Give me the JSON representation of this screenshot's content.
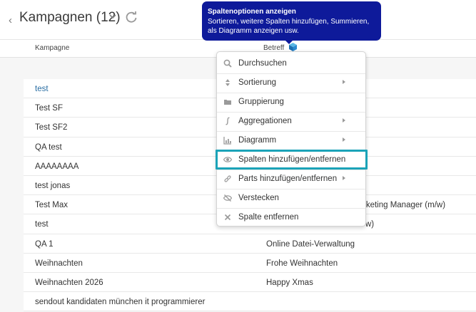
{
  "header": {
    "title": "Kampagnen (12)",
    "back_icon": "chevron-left-icon",
    "title_dropdown_icon": "chevron-down-icon",
    "refresh_icon": "refresh-icon"
  },
  "columns": {
    "col1": "Kampagne",
    "col2": "Betreff",
    "col2_icon": "cube-icon"
  },
  "rows": [
    {
      "name": "test",
      "subject": "",
      "link": true
    },
    {
      "name": "Test SF",
      "subject": ""
    },
    {
      "name": "Test SF2",
      "subject": ""
    },
    {
      "name": "QA test",
      "subject": ""
    },
    {
      "name": "AAAAAAAA",
      "subject": ""
    },
    {
      "name": "test jonas",
      "subject": ""
    },
    {
      "name": "Test Max",
      "subject": "rketing Manager (m/w)"
    },
    {
      "name": "test",
      "subject": "w)"
    },
    {
      "name": "QA 1",
      "subject": "Online Datei-Verwaltung"
    },
    {
      "name": "Weihnachten",
      "subject": "Frohe Weihnachten"
    },
    {
      "name": "Weihnachten 2026",
      "subject": "Happy Xmas"
    },
    {
      "name": "sendout kandidaten münchen it programmierer",
      "subject": ""
    }
  ],
  "tooltip": {
    "title": "Spaltenoptionen anzeigen",
    "body": "Sortieren, weitere Spalten hinzufügen, Summieren, als Diagramm anzeigen usw."
  },
  "menu": {
    "items": [
      {
        "label": "Durchsuchen",
        "icon": "search-icon",
        "submenu": false
      },
      {
        "label": "Sortierung",
        "icon": "sort-icon",
        "submenu": true
      },
      {
        "label": "Gruppierung",
        "icon": "folder-icon",
        "submenu": false
      },
      {
        "label": "Aggregationen",
        "icon": "integral-icon",
        "submenu": true
      },
      {
        "label": "Diagramm",
        "icon": "chart-icon",
        "submenu": true
      },
      {
        "label": "Spalten hinzufügen/entfernen",
        "icon": "eye-icon",
        "submenu": false
      },
      {
        "label": "Parts hinzufügen/entfernen",
        "icon": "link-icon",
        "submenu": true
      },
      {
        "label": "Verstecken",
        "icon": "eye-off-icon",
        "submenu": false
      },
      {
        "label": "Spalte entfernen",
        "icon": "close-icon",
        "submenu": false
      }
    ]
  },
  "colors": {
    "tooltip_bg": "#0e1a9a",
    "highlight": "#1ba3b8",
    "link": "#2a6ea3"
  }
}
